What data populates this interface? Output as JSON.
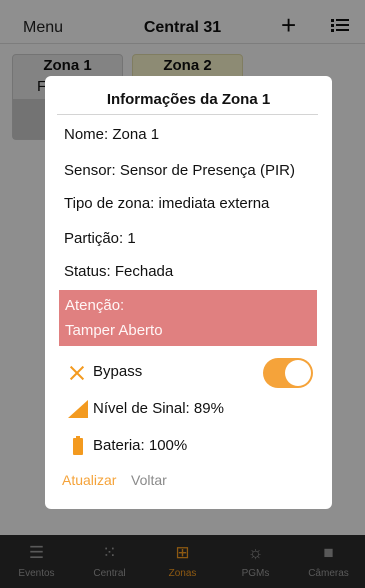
{
  "topbar": {
    "menu": "Menu",
    "title": "Central 31",
    "add_icon": "+"
  },
  "zones": [
    {
      "name": "Zona 1",
      "status_letter": "F"
    },
    {
      "name": "Zona 2"
    }
  ],
  "modal": {
    "title": "Informações da Zona 1",
    "name": "Nome: Zona 1",
    "sensor": "Sensor: Sensor de Presença (PIR)",
    "zone_type": "Tipo de zona: imediata externa",
    "partition": "Partição: 1",
    "status": "Status: Fechada",
    "alert_title": "Atenção:",
    "alert_message": "Tamper Aberto",
    "bypass_label": "Bypass",
    "bypass_on": true,
    "signal": "Nível de Sinal: 89%",
    "battery": "Bateria: 100%",
    "update_button": "Atualizar",
    "back_button": "Voltar"
  },
  "tabs": [
    {
      "label": "Eventos",
      "icon": "list-icon",
      "glyph": "☰"
    },
    {
      "label": "Central",
      "icon": "keypad-icon",
      "glyph": "⁙"
    },
    {
      "label": "Zonas",
      "icon": "zones-grid-icon",
      "glyph": "⊞",
      "active": true
    },
    {
      "label": "PGMs",
      "icon": "lightbulb-icon",
      "glyph": "☼"
    },
    {
      "label": "Câmeras",
      "icon": "camera-icon",
      "glyph": "■"
    }
  ],
  "colors": {
    "accent": "#f39a1f",
    "alert": "#e08080",
    "tabbar": "#2b2b2b"
  }
}
